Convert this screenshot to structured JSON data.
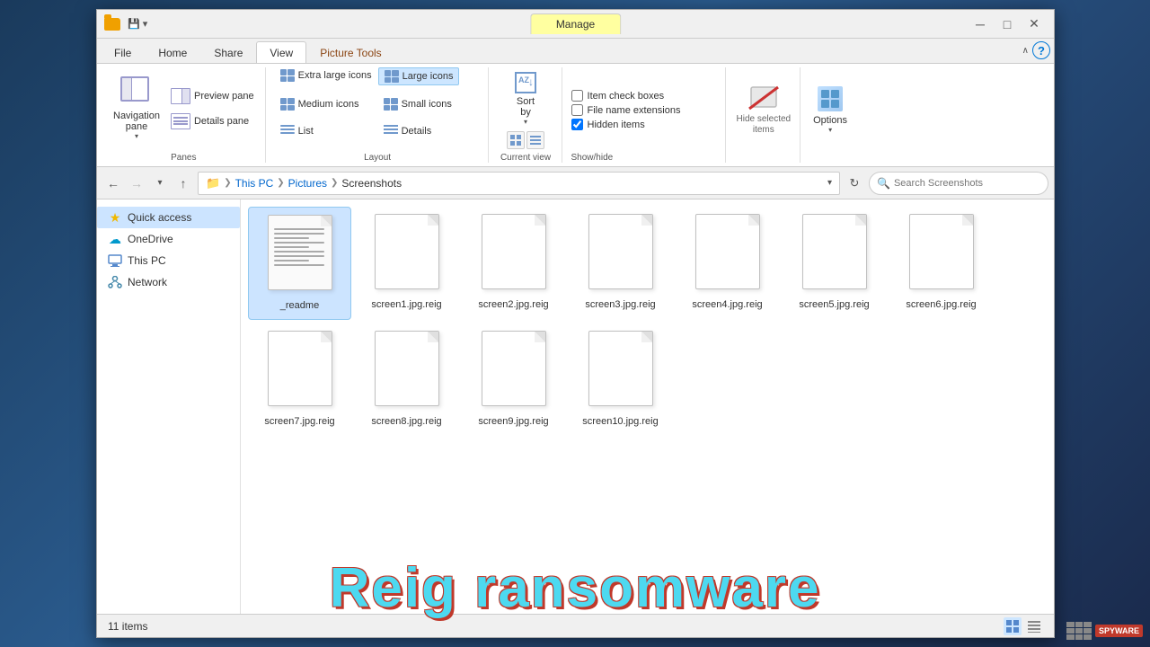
{
  "window": {
    "title": "Screenshots",
    "manage_tab": "Manage",
    "controls": {
      "minimize": "─",
      "maximize": "□",
      "close": "✕"
    }
  },
  "ribbon_tabs": {
    "file": "File",
    "home": "Home",
    "share": "Share",
    "view": "View",
    "picture_tools": "Picture Tools",
    "chevron": "∧",
    "help": "?"
  },
  "ribbon": {
    "panes": {
      "label": "Panes",
      "navigation_pane": "Navigation\npane",
      "navigation_pane_short": "Navigation",
      "navigation_pane_line2": "pane",
      "preview_pane": "Preview pane",
      "details_pane": "Details pane"
    },
    "layout": {
      "label": "Layout",
      "extra_large_icons": "Extra large icons",
      "large_icons": "Large icons",
      "medium_icons": "Medium icons",
      "small_icons": "Small icons",
      "list": "List",
      "details": "Details"
    },
    "current_view": {
      "label": "Current view",
      "sort": "Sort",
      "sort_by": "by"
    },
    "show_hide": {
      "label": "Show/hide",
      "item_check_boxes": "Item check boxes",
      "file_name_extensions": "File name extensions",
      "hidden_items": "Hidden items"
    },
    "hide_selected": {
      "label_line1": "Hide selected",
      "label_line2": "items"
    },
    "options": {
      "label": "Options"
    }
  },
  "addressbar": {
    "breadcrumbs": [
      "This PC",
      "Pictures",
      "Screenshots"
    ],
    "search_placeholder": "Search Screenshots"
  },
  "sidebar": {
    "quick_access": "Quick access",
    "onedrive": "OneDrive",
    "this_pc": "This PC",
    "network": "Network"
  },
  "files": [
    {
      "name": "_readme",
      "type": "readme",
      "selected": true
    },
    {
      "name": "screen1.jpg.reig",
      "type": "generic",
      "selected": false
    },
    {
      "name": "screen2.jpg.reig",
      "type": "generic",
      "selected": false
    },
    {
      "name": "screen3.jpg.reig",
      "type": "generic",
      "selected": false
    },
    {
      "name": "screen4.jpg.reig",
      "type": "generic",
      "selected": false
    },
    {
      "name": "screen5.jpg.reig",
      "type": "generic",
      "selected": false
    },
    {
      "name": "screen6.jpg.reig",
      "type": "generic",
      "selected": false
    },
    {
      "name": "screen7.jpg.reig",
      "type": "generic",
      "selected": false
    },
    {
      "name": "screen8.jpg.reig",
      "type": "generic",
      "selected": false
    },
    {
      "name": "screen9.jpg.reig",
      "type": "generic",
      "selected": false
    },
    {
      "name": "screen10.jpg.reig",
      "type": "generic",
      "selected": false
    }
  ],
  "statusbar": {
    "items_count": "11 items"
  },
  "watermark": {
    "text": "Reig ransomware"
  },
  "show_hide_checks": {
    "item_check_boxes": false,
    "file_name_extensions": false,
    "hidden_items": true
  }
}
